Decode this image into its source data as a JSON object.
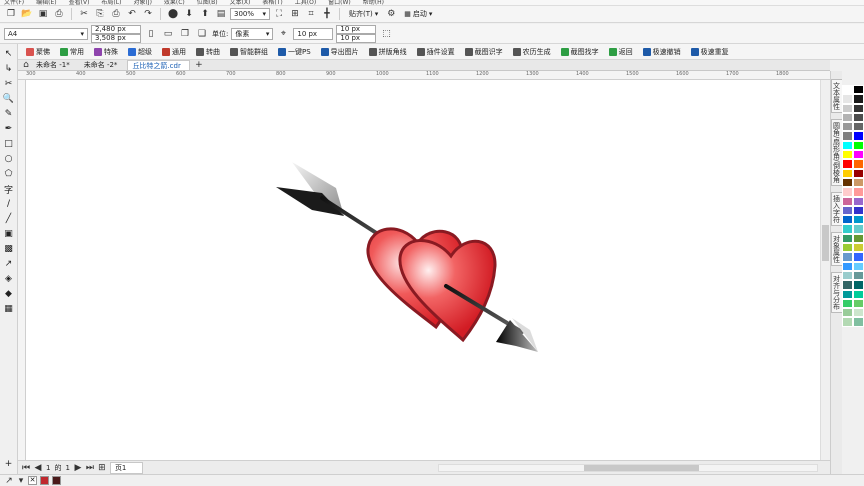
{
  "menu": {
    "items": [
      "文件(F)",
      "编辑(E)",
      "查看(V)",
      "布局(L)",
      "对象(J)",
      "效果(C)",
      "位图(B)",
      "文本(X)",
      "表格(T)",
      "工具(O)",
      "窗口(W)",
      "帮助(H)"
    ]
  },
  "toolbar": {
    "zoom": "300%",
    "snap_label": "贴齐(T)",
    "launch_label": "启动"
  },
  "properties": {
    "page_size": "A4",
    "width": "2,480 px",
    "height": "3,508 px",
    "unit_label": "单位:",
    "unit_value": "像素",
    "nudge": "10 px",
    "dup_x": "10 px",
    "dup_y": "10 px"
  },
  "plugins": [
    {
      "label": "聚佛",
      "color": "#d9534f"
    },
    {
      "label": "常用",
      "color": "#2e9e44"
    },
    {
      "label": "特殊",
      "color": "#8e44ad"
    },
    {
      "label": "超级",
      "color": "#2b6cd4"
    },
    {
      "label": "通用",
      "color": "#c0392b"
    },
    {
      "label": "转曲",
      "color": "#555555"
    },
    {
      "label": "智能群组",
      "color": "#555555"
    },
    {
      "label": "一键PS",
      "color": "#1e5aa8"
    },
    {
      "label": "导出图片",
      "color": "#1e5aa8"
    },
    {
      "label": "拼版角线",
      "color": "#555555"
    },
    {
      "label": "插件设置",
      "color": "#555555"
    },
    {
      "label": "截图识字",
      "color": "#555555"
    },
    {
      "label": "农历生成",
      "color": "#555555"
    },
    {
      "label": "截图找字",
      "color": "#2e9e44"
    },
    {
      "label": "返回",
      "color": "#2e9e44"
    },
    {
      "label": "极速撤销",
      "color": "#1e5aa8"
    },
    {
      "label": "极速重复",
      "color": "#1e5aa8"
    }
  ],
  "doc_tabs": [
    {
      "label": "未命名 -1*"
    },
    {
      "label": "未命名 -2*"
    },
    {
      "label": "丘比特之箭.cdr"
    }
  ],
  "ruler": {
    "ticks": [
      "300",
      "400",
      "500",
      "600",
      "700",
      "800",
      "900",
      "1000",
      "1100",
      "1200",
      "1300",
      "1400",
      "1500",
      "1600",
      "1700",
      "1800"
    ]
  },
  "dockers": [
    "文本属性",
    "圆角/扇形角/倒棱角",
    "插入字符",
    "对象属性",
    "对齐与分布"
  ],
  "page_nav": {
    "current": "1",
    "of_label": "的",
    "total": "1",
    "page_tab": "页1"
  },
  "palette_colors": [
    "#ffffff",
    "#000000",
    "#e6e6e6",
    "#1a1a1a",
    "#cccccc",
    "#333333",
    "#b3b3b3",
    "#4d4d4d",
    "#999999",
    "#666666",
    "#808080",
    "#0000ff",
    "#00ffff",
    "#00ff00",
    "#ffff00",
    "#ff00ff",
    "#ff0000",
    "#ff6600",
    "#ffcc00",
    "#990000",
    "#663300",
    "#cc9966",
    "#ffcccc",
    "#ff9999",
    "#cc6699",
    "#9966cc",
    "#6666cc",
    "#3333cc",
    "#0066cc",
    "#0099cc",
    "#33cccc",
    "#66cccc",
    "#339966",
    "#669933",
    "#99cc33",
    "#cccc33",
    "#6699cc",
    "#3366ff",
    "#3399ff",
    "#66ccff",
    "#99cccc",
    "#669999",
    "#336666",
    "#006666",
    "#009999",
    "#00cc99",
    "#33cc66",
    "#66cc66",
    "#99cc99",
    "#cce5cc",
    "#b3d9b3",
    "#80bfa0"
  ],
  "status": {
    "fill_color": "#c0282e",
    "outline_color": "#4a1a1a"
  }
}
